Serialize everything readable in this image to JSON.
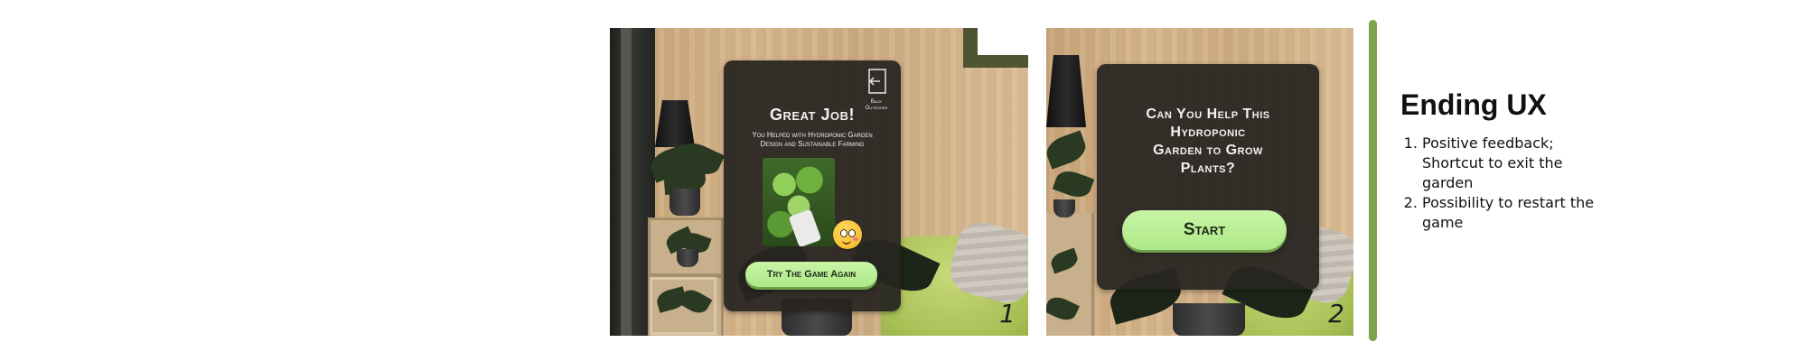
{
  "screen1": {
    "back_label_line1": "Back",
    "back_label_line2": "Outdoors",
    "title": "Great Job!",
    "subtitle_line1": "You Helped with Hydroponic Garden",
    "subtitle_line2": "Design and Sustainable Farming",
    "retry_button": "Try The Game Again",
    "step_number": "1"
  },
  "screen2": {
    "question_line1": "Can You Help This",
    "question_line2": "Hydroponic",
    "question_line3": "Garden to Grow",
    "question_line4": "Plants?",
    "start_button": "Start",
    "step_number": "2"
  },
  "notes": {
    "title": "Ending UX",
    "items": [
      "Positive feedback; Shortcut to exit the garden",
      "Possibility to restart the game"
    ]
  },
  "colors": {
    "accent_bar": "#7fa34a",
    "button_green": "#b9ef92",
    "panel_dark": "#28251f"
  },
  "icons": {
    "back_icon": "door-exit-arrow-icon",
    "emoji": "smiling-face-emoji"
  }
}
